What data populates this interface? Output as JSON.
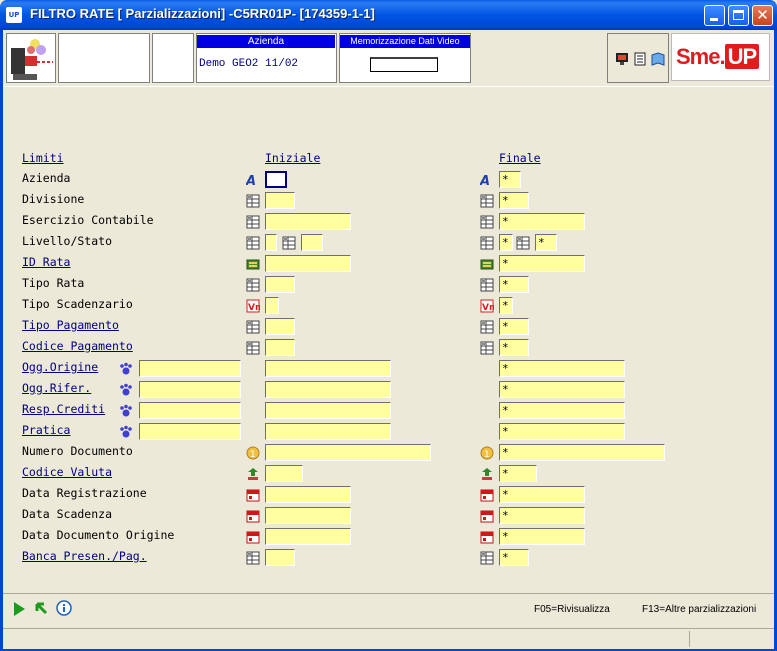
{
  "window": {
    "title": "FILTRO RATE [ Parzializzazioni] -C5RR01P- [174359-1-1]",
    "app_icon": "UP",
    "controls": [
      "minimize-icon",
      "maximize-icon",
      "close-icon"
    ]
  },
  "header": {
    "azienda_label": "Azienda",
    "azienda_value": "Demo GEO2 11/02",
    "memo_label": "Memorizzazione Dati Video",
    "memo_value": "",
    "brand": {
      "sme": "Sme.",
      "up": "UP",
      "color": "#E21C1C"
    }
  },
  "form": {
    "col_limiti": "Limiti",
    "col_iniziale": "Iniziale",
    "col_finale": "Finale",
    "rows": [
      {
        "label": "Azienda",
        "link": false,
        "icon": "azienda-icon",
        "ini": "",
        "fin": "*"
      },
      {
        "label": "Divisione",
        "link": false,
        "icon": "table-icon",
        "ini": "",
        "fin": "*"
      },
      {
        "label": "Esercizio Contabile",
        "link": false,
        "icon": "table-icon",
        "ini": "",
        "fin": "*"
      },
      {
        "label": "Livello/Stato",
        "link": false,
        "icon": "table-icon",
        "ini": "",
        "ini2": "",
        "fin": "*",
        "fin2": "*"
      },
      {
        "label": "ID Rata",
        "link": true,
        "icon": "rata-icon",
        "ini": "",
        "fin": "*"
      },
      {
        "label": "Tipo Rata",
        "link": false,
        "icon": "table-icon",
        "ini": "",
        "fin": "*"
      },
      {
        "label": "Tipo Scadenzario",
        "link": false,
        "icon": "value-icon",
        "ini": "",
        "fin": "*"
      },
      {
        "label": "Tipo Pagamento",
        "link": true,
        "icon": "table-icon",
        "ini": "",
        "fin": "*"
      },
      {
        "label": "Codice Pagamento",
        "link": true,
        "icon": "table-icon",
        "ini": "",
        "fin": "*"
      },
      {
        "label": "Ogg.Origine",
        "link": true,
        "icon": "paw-icon",
        "obj": "",
        "ini": "",
        "fin": "*"
      },
      {
        "label": "Ogg.Rifer.",
        "link": true,
        "icon": "paw-icon",
        "obj": "",
        "ini": "",
        "fin": "*"
      },
      {
        "label": "Resp.Crediti",
        "link": true,
        "icon": "paw-icon",
        "obj": "",
        "ini": "",
        "fin": "*"
      },
      {
        "label": "Pratica",
        "link": true,
        "icon": "paw-icon",
        "obj": "",
        "ini": "",
        "fin": "*"
      },
      {
        "label": "Numero Documento",
        "link": false,
        "icon": "number-icon",
        "ini": "",
        "fin": "*"
      },
      {
        "label": "Codice Valuta",
        "link": true,
        "icon": "currency-icon",
        "ini": "",
        "fin": "*"
      },
      {
        "label": "Data Registrazione",
        "link": false,
        "icon": "calendar-icon",
        "ini": "",
        "fin": "*"
      },
      {
        "label": "Data Scadenza",
        "link": false,
        "icon": "calendar-icon",
        "ini": "",
        "fin": "*"
      },
      {
        "label": "Data Documento Origine",
        "link": false,
        "icon": "calendar-icon",
        "ini": "",
        "fin": "*"
      },
      {
        "label": "Banca Presen./Pag.",
        "link": true,
        "icon": "table-icon",
        "ini": "",
        "fin": "*"
      }
    ]
  },
  "footer": {
    "f05": "F05=Rivisualizza",
    "f13": "F13=Altre parzializzazioni",
    "icons": [
      "play-icon",
      "back-icon",
      "info-icon"
    ]
  },
  "colors": {
    "field_bg": "#FFFFA0",
    "link": "#000080",
    "titlebar": "#0055E5"
  }
}
